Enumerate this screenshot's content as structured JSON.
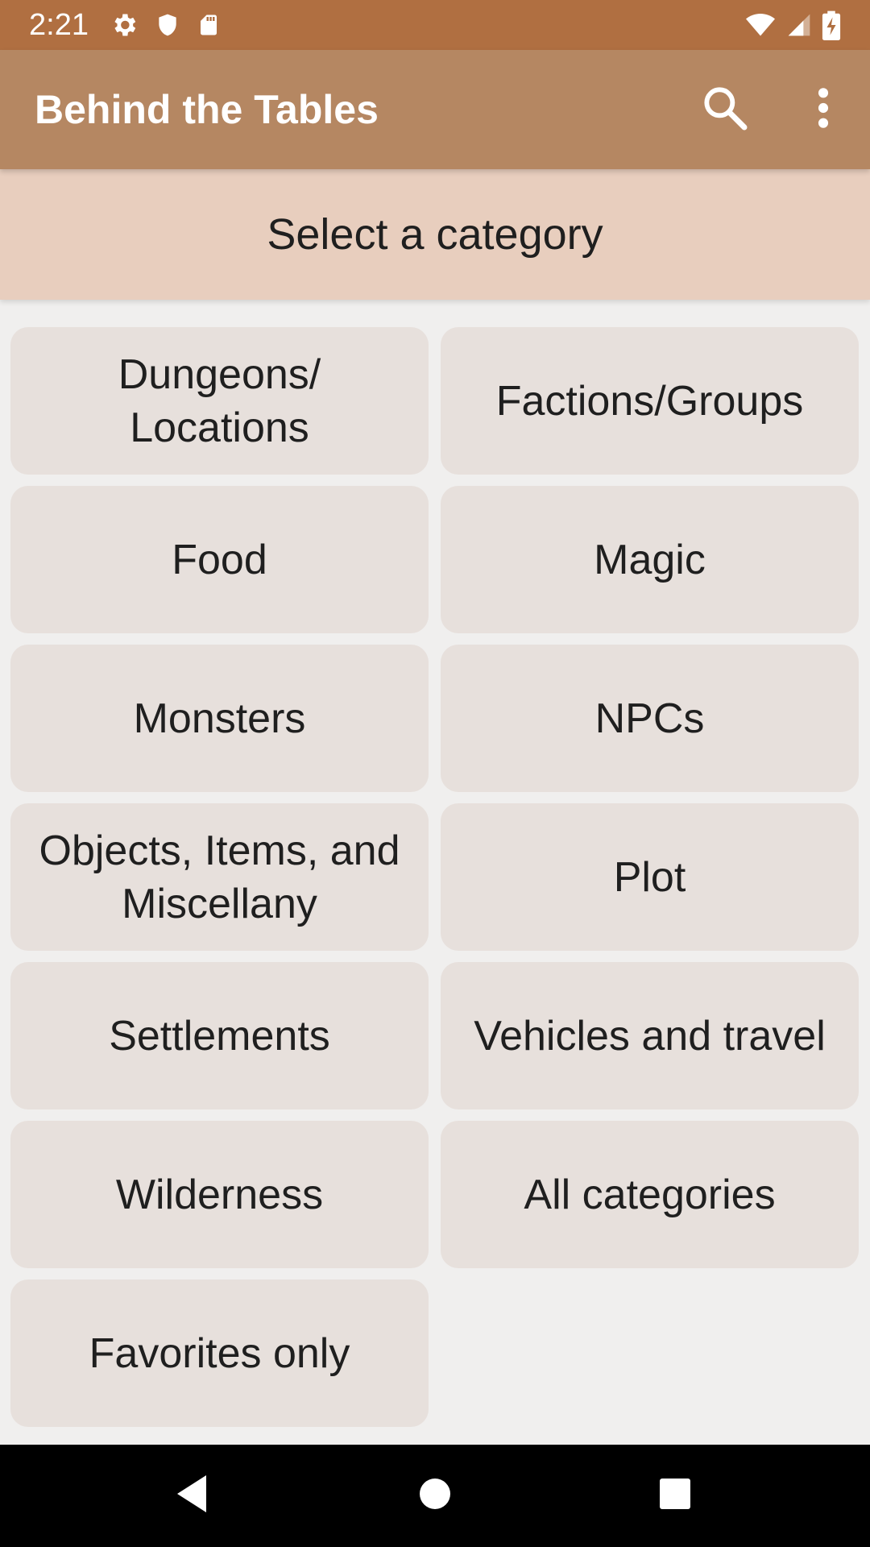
{
  "status_bar": {
    "time": "2:21",
    "left_icons": [
      "gear-icon",
      "shield-icon",
      "sd-card-icon"
    ],
    "right_icons": [
      "wifi-icon",
      "cell-signal-icon",
      "battery-charging-icon"
    ]
  },
  "app_bar": {
    "title": "Behind the Tables",
    "actions": [
      "search-icon",
      "more-vert-icon"
    ]
  },
  "header": {
    "text": "Select a category"
  },
  "categories": [
    "Dungeons/\nLocations",
    "Factions/Groups",
    "Food",
    "Magic",
    "Monsters",
    "NPCs",
    "Objects, Items, and\nMiscellany",
    "Plot",
    "Settlements",
    "Vehicles and travel",
    "Wilderness",
    "All categories",
    "Favorites only"
  ],
  "nav_bar": {
    "buttons": [
      "back-icon",
      "home-icon",
      "recents-icon"
    ]
  },
  "colors": {
    "status_bar": "#b06f41",
    "app_bar": "#b58762",
    "header_bg": "#e8cebe",
    "page_bg": "#f0efee",
    "button_bg": "#e7e0dc",
    "nav_bar": "#000000"
  }
}
